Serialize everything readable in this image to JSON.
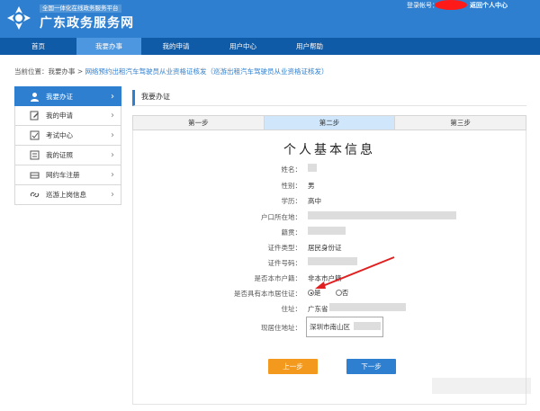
{
  "header": {
    "subtitle": "全国一体化在线政务服务平台",
    "title": "广东政务服务网",
    "login_label": "登录帐号：",
    "back_link": "返回个人中心"
  },
  "nav": {
    "items": [
      {
        "label": "首页"
      },
      {
        "label": "我要办事"
      },
      {
        "label": "我的申请"
      },
      {
        "label": "用户中心"
      },
      {
        "label": "用户帮助"
      }
    ],
    "active": "我要办事"
  },
  "breadcrumb": {
    "prefix": "当前位置：",
    "item1": "我要办事",
    "sep": " > ",
    "item2": "网络预约出租汽车驾驶员从业资格证核发（巡游出租汽车驾驶员从业资格证核发）"
  },
  "sidebar": {
    "items": [
      {
        "label": "我要办证",
        "icon": "user-icon"
      },
      {
        "label": "我的申请",
        "icon": "edit-icon"
      },
      {
        "label": "考试中心",
        "icon": "exam-icon"
      },
      {
        "label": "我的证照",
        "icon": "certificate-icon"
      },
      {
        "label": "网约车注册",
        "icon": "car-icon"
      },
      {
        "label": "巡游上岗信息",
        "icon": "link-icon"
      }
    ],
    "arrow": "›"
  },
  "panel": {
    "title": "我要办证"
  },
  "steps": [
    {
      "label": "第一步"
    },
    {
      "label": "第二步"
    },
    {
      "label": "第三步"
    }
  ],
  "active_step": "第二步",
  "form": {
    "title": "个人基本信息",
    "labels": {
      "name": "姓名：",
      "gender": "性别：",
      "education": "学历：",
      "hukou_addr": "户口所在地：",
      "native_place": "籍贯：",
      "id_type": "证件类型：",
      "id_number": "证件号码：",
      "local_hukou": "是否本市户籍：",
      "residence_permit": "是否具有本市居住证：",
      "address": "住址：",
      "current_address": "现居住地址："
    },
    "values": {
      "gender": "男",
      "education": "高中",
      "id_type": "居民身份证",
      "local_hukou": "非本市户籍",
      "residence_yes": "是",
      "residence_no": "否",
      "address_prefix": "广东省",
      "current_address": "深圳市南山区"
    },
    "residence_selected": "是"
  },
  "buttons": {
    "prev": "上一步",
    "next": "下一步"
  },
  "colors": {
    "header_bg": "#2e7fd0",
    "nav_bg": "#0f5ba8",
    "accent": "#2e7fd0",
    "prev_button": "#f39a1e",
    "annotation_arrow": "#e02020"
  }
}
